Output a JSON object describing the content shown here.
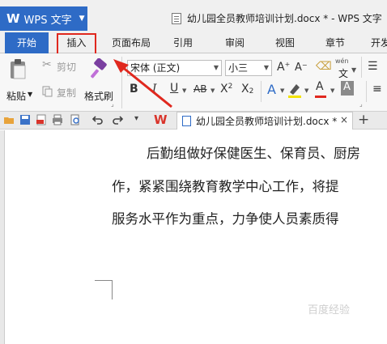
{
  "app": {
    "name": "WPS 文字",
    "window_title": "幼儿园全员教师培训计划.docx * - WPS 文字"
  },
  "tabs": [
    {
      "label": "开始",
      "active": true
    },
    {
      "label": "插入",
      "active": false
    },
    {
      "label": "页面布局",
      "active": false
    },
    {
      "label": "引用",
      "active": false
    },
    {
      "label": "审阅",
      "active": false
    },
    {
      "label": "视图",
      "active": false
    },
    {
      "label": "章节",
      "active": false
    },
    {
      "label": "开发",
      "active": false
    }
  ],
  "ribbon": {
    "paste_label": "粘贴",
    "cut_label": "剪切",
    "copy_label": "复制",
    "format_painter_label": "格式刷",
    "font_name": "宋体 (正文)",
    "font_size": "小三",
    "wen_label": "wén",
    "wen_char": "文",
    "bold": "B",
    "italic": "I",
    "underline": "U",
    "strike": "AB",
    "superscript_base": "X",
    "superscript_mark": "2",
    "subscript_base": "X",
    "subscript_mark": "2",
    "grow_font": "A",
    "shrink_font": "A",
    "text_effect": "A",
    "font_color": "A",
    "char_shading": "A"
  },
  "document_tab": {
    "label": "幼儿园全员教师培训计划.docx *",
    "close": "×",
    "new_tab": "+"
  },
  "document": {
    "lines": [
      "后勤组做好保健医生、保育员、厨房",
      "作，紧紧围绕教育教学中心工作，将提",
      "服务水平作为重点，力争使人员素质得"
    ]
  },
  "watermark": "百度经验",
  "colors": {
    "accent": "#2e6bc6",
    "highlight_red": "#e0281e"
  }
}
